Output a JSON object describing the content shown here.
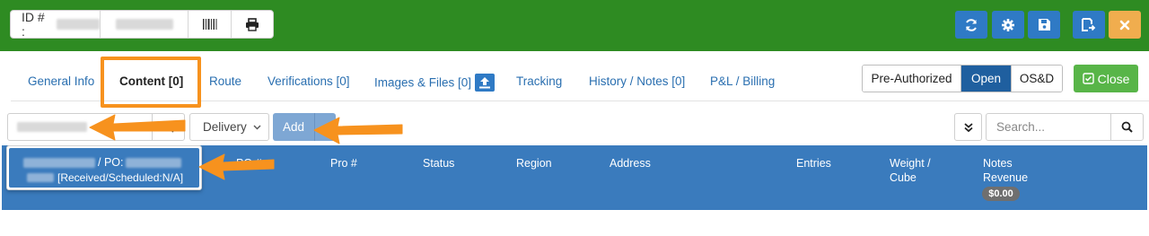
{
  "header": {
    "id_label": "ID # :",
    "buttons": [
      {
        "name": "refresh-icon",
        "color": "#2f7ac5"
      },
      {
        "name": "gear-icon",
        "color": "#2f7ac5"
      },
      {
        "name": "save-icon",
        "color": "#2f7ac5"
      },
      {
        "name": "save-and-close-icon",
        "color": "#2f7ac5"
      },
      {
        "name": "close-icon",
        "color": "#f0ad4e"
      }
    ],
    "bar_color": "#2e8b22"
  },
  "tabs": [
    {
      "label": "General Info"
    },
    {
      "label": "Content [0]",
      "active": true
    },
    {
      "label": "Route"
    },
    {
      "label": "Verifications [0]"
    },
    {
      "label": "Images & Files [0]"
    },
    {
      "label": "Tracking"
    },
    {
      "label": "History / Notes [0]"
    },
    {
      "label": "P&L / Billing"
    }
  ],
  "status_toggle": {
    "options": [
      "Pre-Authorized",
      "Open",
      "OS&D"
    ],
    "selected": "Open"
  },
  "close_button": {
    "label": "Close"
  },
  "controls": {
    "delivery_select": "Delivery",
    "add_label": "Add",
    "search_placeholder": "Search..."
  },
  "suggestion": {
    "po_label": "/ PO:",
    "status_text": "[Received/Scheduled:N/A]"
  },
  "table": {
    "columns": [
      "PO #",
      "Pro #",
      "Status",
      "Region",
      "Address",
      "Entries",
      "Weight /",
      "Cube",
      "Notes",
      "Revenue"
    ],
    "revenue_total": "$0.00"
  },
  "annotation_color": "#f7921e"
}
